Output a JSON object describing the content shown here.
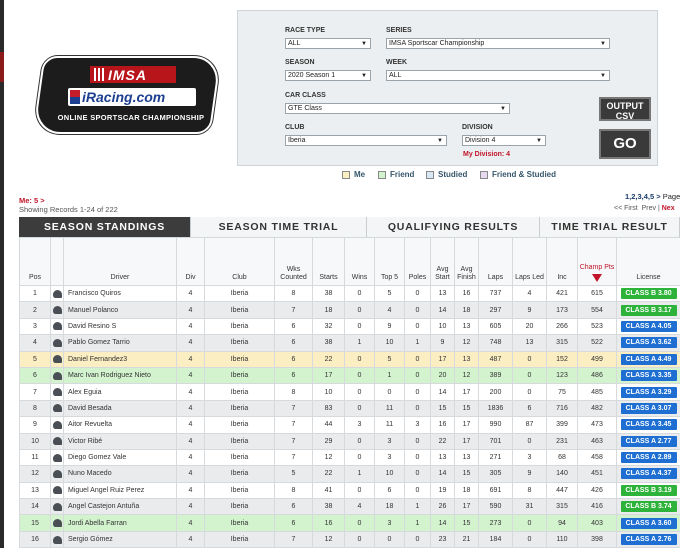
{
  "logo": {
    "imsa": "IMSA",
    "iracing": "iRacing.com",
    "subtitle": "ONLINE SPORTSCAR CHAMPIONSHIP"
  },
  "filters": {
    "race_type": {
      "label": "RACE TYPE",
      "value": "ALL"
    },
    "series": {
      "label": "SERIES",
      "value": "IMSA Sportscar Championship"
    },
    "season": {
      "label": "SEASON",
      "value": "2020 Season 1"
    },
    "week": {
      "label": "WEEK",
      "value": "ALL"
    },
    "car_class": {
      "label": "CAR CLASS",
      "value": "GTE Class"
    },
    "club": {
      "label": "CLUB",
      "value": "Iberia"
    },
    "division": {
      "label": "DIVISION",
      "value": "Division 4"
    },
    "my_division": "My Division: 4",
    "output_csv": "OUTPUT CSV",
    "go": "GO"
  },
  "legend": [
    {
      "label": "Me",
      "color": "#fbeec2"
    },
    {
      "label": "Friend",
      "color": "#d3f3cf"
    },
    {
      "label": "Studied",
      "color": "#d9e8f5"
    },
    {
      "label": "Friend & Studied",
      "color": "#e6d9f0"
    }
  ],
  "me_link": "Me: 5 >",
  "records": "Showing Records 1-24 of 222",
  "pager": {
    "pages": "1,2,3,4,5 >",
    "page_label": "Page",
    "first": "<< First",
    "prev": "Prev",
    "next": "Nex"
  },
  "tabs": [
    "SEASON STANDINGS",
    "SEASON TIME TRIAL",
    "QUALIFYING RESULTS",
    "TIME TRIAL RESULT"
  ],
  "columns": [
    "Pos",
    "Driver",
    "Div",
    "Club",
    "Wks Counted",
    "Starts",
    "Wins",
    "Top 5",
    "Poles",
    "Avg Start",
    "Avg Finish",
    "Laps",
    "Laps Led",
    "Inc",
    "Champ Pts",
    "License"
  ],
  "rows": [
    {
      "pos": "1",
      "driver": "Francisco Quiros",
      "div": "4",
      "club": "Iberia",
      "wks": "8",
      "starts": "38",
      "wins": "0",
      "top5": "5",
      "poles": "0",
      "avgs": "13",
      "avgf": "16",
      "laps": "737",
      "led": "4",
      "inc": "421",
      "pts": "615",
      "lic": "CLASS B 3.80",
      "lic_color": "#2db33a",
      "style": "odd"
    },
    {
      "pos": "2",
      "driver": "Manuel Polanco",
      "div": "4",
      "club": "Iberia",
      "wks": "7",
      "starts": "18",
      "wins": "0",
      "top5": "4",
      "poles": "0",
      "avgs": "14",
      "avgf": "18",
      "laps": "297",
      "led": "9",
      "inc": "173",
      "pts": "554",
      "lic": "CLASS B 3.17",
      "lic_color": "#2db33a",
      "style": "even"
    },
    {
      "pos": "3",
      "driver": "David Resino S",
      "div": "4",
      "club": "Iberia",
      "wks": "6",
      "starts": "32",
      "wins": "0",
      "top5": "9",
      "poles": "0",
      "avgs": "10",
      "avgf": "13",
      "laps": "605",
      "led": "20",
      "inc": "266",
      "pts": "523",
      "lic": "CLASS A 4.05",
      "lic_color": "#1e6fd1",
      "style": "odd"
    },
    {
      "pos": "4",
      "driver": "Pablo Gomez Tarrio",
      "div": "4",
      "club": "Iberia",
      "wks": "6",
      "starts": "38",
      "wins": "1",
      "top5": "10",
      "poles": "1",
      "avgs": "9",
      "avgf": "12",
      "laps": "748",
      "led": "13",
      "inc": "315",
      "pts": "522",
      "lic": "CLASS A 3.62",
      "lic_color": "#1e6fd1",
      "style": "even"
    },
    {
      "pos": "5",
      "driver": "Daniel Fernandez3",
      "div": "4",
      "club": "Iberia",
      "wks": "6",
      "starts": "22",
      "wins": "0",
      "top5": "5",
      "poles": "0",
      "avgs": "17",
      "avgf": "13",
      "laps": "487",
      "led": "0",
      "inc": "152",
      "pts": "499",
      "lic": "CLASS A 4.49",
      "lic_color": "#1e6fd1",
      "style": "me"
    },
    {
      "pos": "6",
      "driver": "Marc Ivan Rodriguez Nieto",
      "div": "4",
      "club": "Iberia",
      "wks": "6",
      "starts": "17",
      "wins": "0",
      "top5": "1",
      "poles": "0",
      "avgs": "20",
      "avgf": "12",
      "laps": "389",
      "led": "0",
      "inc": "123",
      "pts": "486",
      "lic": "CLASS A 3.35",
      "lic_color": "#1e6fd1",
      "style": "friend"
    },
    {
      "pos": "7",
      "driver": "Alex Eguia",
      "div": "4",
      "club": "Iberia",
      "wks": "8",
      "starts": "10",
      "wins": "0",
      "top5": "0",
      "poles": "0",
      "avgs": "14",
      "avgf": "17",
      "laps": "200",
      "led": "0",
      "inc": "75",
      "pts": "485",
      "lic": "CLASS A 3.29",
      "lic_color": "#1e6fd1",
      "style": "odd"
    },
    {
      "pos": "8",
      "driver": "David Besada",
      "div": "4",
      "club": "Iberia",
      "wks": "7",
      "starts": "83",
      "wins": "0",
      "top5": "11",
      "poles": "0",
      "avgs": "15",
      "avgf": "15",
      "laps": "1836",
      "led": "6",
      "inc": "716",
      "pts": "482",
      "lic": "CLASS A 3.07",
      "lic_color": "#1e6fd1",
      "style": "even"
    },
    {
      "pos": "9",
      "driver": "Aitor Revuelta",
      "div": "4",
      "club": "Iberia",
      "wks": "7",
      "starts": "44",
      "wins": "3",
      "top5": "11",
      "poles": "3",
      "avgs": "16",
      "avgf": "17",
      "laps": "990",
      "led": "87",
      "inc": "399",
      "pts": "473",
      "lic": "CLASS A 3.45",
      "lic_color": "#1e6fd1",
      "style": "odd"
    },
    {
      "pos": "10",
      "driver": "Victor Ribé",
      "div": "4",
      "club": "Iberia",
      "wks": "7",
      "starts": "29",
      "wins": "0",
      "top5": "3",
      "poles": "0",
      "avgs": "22",
      "avgf": "17",
      "laps": "701",
      "led": "0",
      "inc": "231",
      "pts": "463",
      "lic": "CLASS A 2.77",
      "lic_color": "#1e6fd1",
      "style": "even"
    },
    {
      "pos": "11",
      "driver": "Diego Gomez Vale",
      "div": "4",
      "club": "Iberia",
      "wks": "7",
      "starts": "12",
      "wins": "0",
      "top5": "3",
      "poles": "0",
      "avgs": "13",
      "avgf": "13",
      "laps": "271",
      "led": "3",
      "inc": "68",
      "pts": "458",
      "lic": "CLASS A 2.89",
      "lic_color": "#1e6fd1",
      "style": "odd"
    },
    {
      "pos": "12",
      "driver": "Nuno Macedo",
      "div": "4",
      "club": "Iberia",
      "wks": "5",
      "starts": "22",
      "wins": "1",
      "top5": "10",
      "poles": "0",
      "avgs": "14",
      "avgf": "15",
      "laps": "305",
      "led": "9",
      "inc": "140",
      "pts": "451",
      "lic": "CLASS A 4.37",
      "lic_color": "#1e6fd1",
      "style": "even"
    },
    {
      "pos": "13",
      "driver": "Miguel Angel Ruiz Perez",
      "div": "4",
      "club": "Iberia",
      "wks": "8",
      "starts": "41",
      "wins": "0",
      "top5": "6",
      "poles": "0",
      "avgs": "19",
      "avgf": "18",
      "laps": "691",
      "led": "8",
      "inc": "447",
      "pts": "426",
      "lic": "CLASS B 3.19",
      "lic_color": "#2db33a",
      "style": "odd"
    },
    {
      "pos": "14",
      "driver": "Angel Castejon Antuña",
      "div": "4",
      "club": "Iberia",
      "wks": "6",
      "starts": "38",
      "wins": "4",
      "top5": "18",
      "poles": "1",
      "avgs": "26",
      "avgf": "17",
      "laps": "590",
      "led": "31",
      "inc": "315",
      "pts": "416",
      "lic": "CLASS B 3.74",
      "lic_color": "#2db33a",
      "style": "even"
    },
    {
      "pos": "15",
      "driver": "Jordi Abella Farran",
      "div": "4",
      "club": "Iberia",
      "wks": "6",
      "starts": "16",
      "wins": "0",
      "top5": "3",
      "poles": "1",
      "avgs": "14",
      "avgf": "15",
      "laps": "273",
      "led": "0",
      "inc": "94",
      "pts": "403",
      "lic": "CLASS A 3.60",
      "lic_color": "#1e6fd1",
      "style": "friend"
    },
    {
      "pos": "16",
      "driver": "Sergio Gómez",
      "div": "4",
      "club": "Iberia",
      "wks": "7",
      "starts": "12",
      "wins": "0",
      "top5": "0",
      "poles": "0",
      "avgs": "23",
      "avgf": "21",
      "laps": "184",
      "led": "0",
      "inc": "110",
      "pts": "398",
      "lic": "CLASS A 2.76",
      "lic_color": "#1e6fd1",
      "style": "even"
    }
  ]
}
